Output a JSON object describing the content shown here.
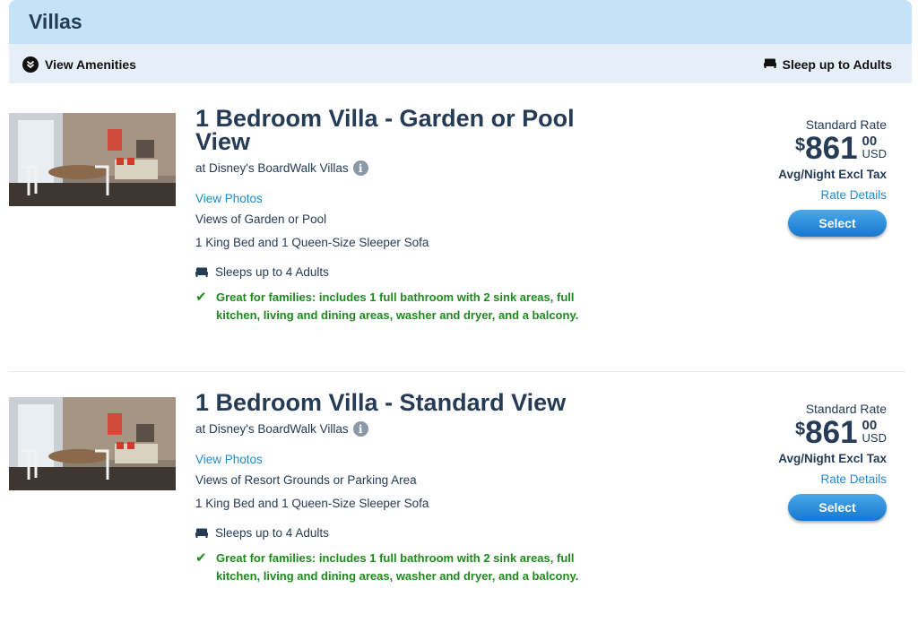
{
  "header": {
    "title": "Villas"
  },
  "subbar": {
    "amenities_label": "View Amenities",
    "sleep_label": "Sleep up to Adults"
  },
  "rooms": [
    {
      "title": "1 Bedroom Villa - Garden or Pool View",
      "resort": "at Disney's BoardWalk Villas",
      "info_icon": "info-icon",
      "view_photos": "View Photos",
      "view": "Views of Garden or Pool",
      "beds": "1 King Bed and 1 Queen-Size Sleeper Sofa",
      "sleeps": "Sleeps up to 4 Adults",
      "feature": "Great for families: includes 1 full bathroom with 2 sink areas, full kitchen, living and dining areas, washer and dryer, and a balcony.",
      "rate_label": "Standard Rate",
      "currency_symbol": "$",
      "price": "861",
      "cents": "00",
      "currency": "USD",
      "per_night": "Avg/Night Excl Tax",
      "rate_details": "Rate Details",
      "select_label": "Select"
    },
    {
      "title": "1 Bedroom Villa - Standard View",
      "resort": "at Disney's BoardWalk Villas",
      "info_icon": "info-icon",
      "view_photos": "View Photos",
      "view": "Views of Resort Grounds or Parking Area",
      "beds": "1 King Bed and 1 Queen-Size Sleeper Sofa",
      "sleeps": "Sleeps up to 4 Adults",
      "feature": "Great for families: includes 1 full bathroom with 2 sink areas, full kitchen, living and dining areas, washer and dryer, and a balcony.",
      "rate_label": "Standard Rate",
      "currency_symbol": "$",
      "price": "861",
      "cents": "00",
      "currency": "USD",
      "per_night": "Avg/Night Excl Tax",
      "rate_details": "Rate Details",
      "select_label": "Select"
    }
  ],
  "colors": {
    "heading": "#253b56",
    "link": "#1c8bd1",
    "feature_green": "#1e8a1e",
    "header_bg": "#c5e3f6",
    "subbar_bg": "#e6eff8",
    "button": "#1c86d8"
  }
}
